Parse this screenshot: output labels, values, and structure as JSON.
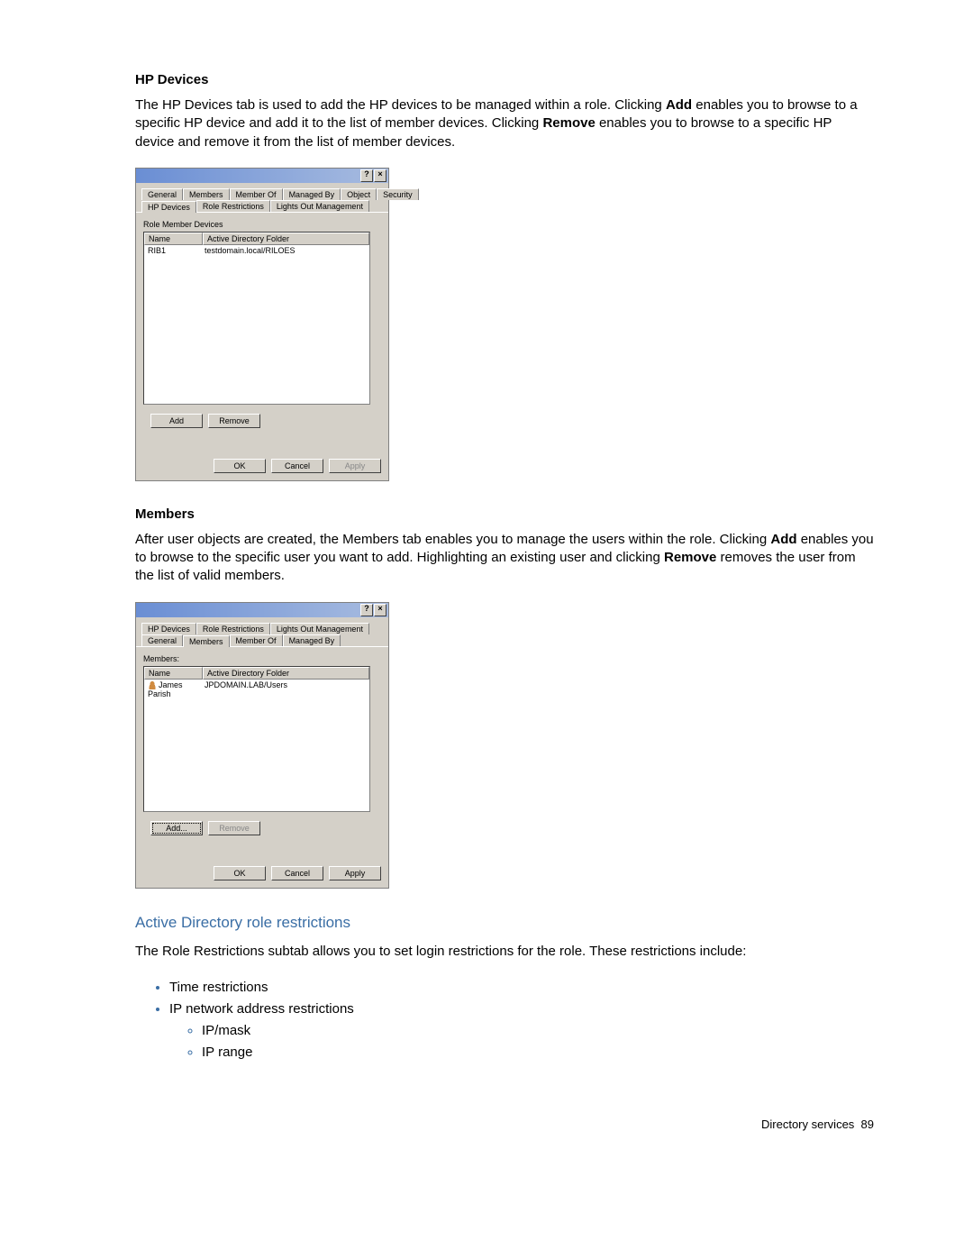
{
  "section1": {
    "heading": "HP Devices",
    "para_a": "The HP Devices tab is used to add the HP devices to be managed within a role. Clicking ",
    "para_b": " enables you to browse to a specific HP device and add it to the list of member devices. Clicking ",
    "para_c": " enables you to browse to a specific HP device and remove it from the list of member devices.",
    "bold1": "Add",
    "bold2": "Remove"
  },
  "dialog1": {
    "titlebar": {
      "help": "?",
      "close": "×"
    },
    "tabs_row1": [
      "General",
      "Members",
      "Member Of",
      "Managed By",
      "Object",
      "Security"
    ],
    "tabs_row2": [
      "HP Devices",
      "Role Restrictions",
      "Lights Out Management"
    ],
    "group_label": "Role Member Devices",
    "columns": [
      "Name",
      "Active Directory Folder"
    ],
    "row": {
      "name": "RIB1",
      "folder": "testdomain.local/RILOES"
    },
    "buttons": {
      "add": "Add",
      "remove": "Remove",
      "ok": "OK",
      "cancel": "Cancel",
      "apply": "Apply"
    }
  },
  "section2": {
    "heading": "Members",
    "para_a": "After user objects are created, the Members tab enables you to manage the users within the role. Clicking ",
    "para_b": " enables you to browse to the specific user you want to add. Highlighting an existing user and clicking ",
    "para_c": " removes the user from the list of valid members.",
    "bold1": "Add",
    "bold2": "Remove"
  },
  "dialog2": {
    "titlebar": {
      "help": "?",
      "close": "×"
    },
    "tabs_row1": [
      "HP Devices",
      "Role Restrictions",
      "Lights Out Management"
    ],
    "tabs_row2": [
      "General",
      "Members",
      "Member Of",
      "Managed By"
    ],
    "group_label": "Members:",
    "columns": [
      "Name",
      "Active Directory Folder"
    ],
    "row": {
      "name": "James Parish",
      "folder": "JPDOMAIN.LAB/Users"
    },
    "buttons": {
      "add": "Add...",
      "remove": "Remove",
      "ok": "OK",
      "cancel": "Cancel",
      "apply": "Apply"
    }
  },
  "section3": {
    "heading": "Active Directory role restrictions",
    "para": "The Role Restrictions subtab allows you to set login restrictions for the role. These restrictions include:",
    "bullets": [
      "Time restrictions",
      "IP network address restrictions"
    ],
    "sub_bullets": [
      "IP/mask",
      "IP range"
    ]
  },
  "footer": {
    "text": "Directory services",
    "page": "89"
  }
}
